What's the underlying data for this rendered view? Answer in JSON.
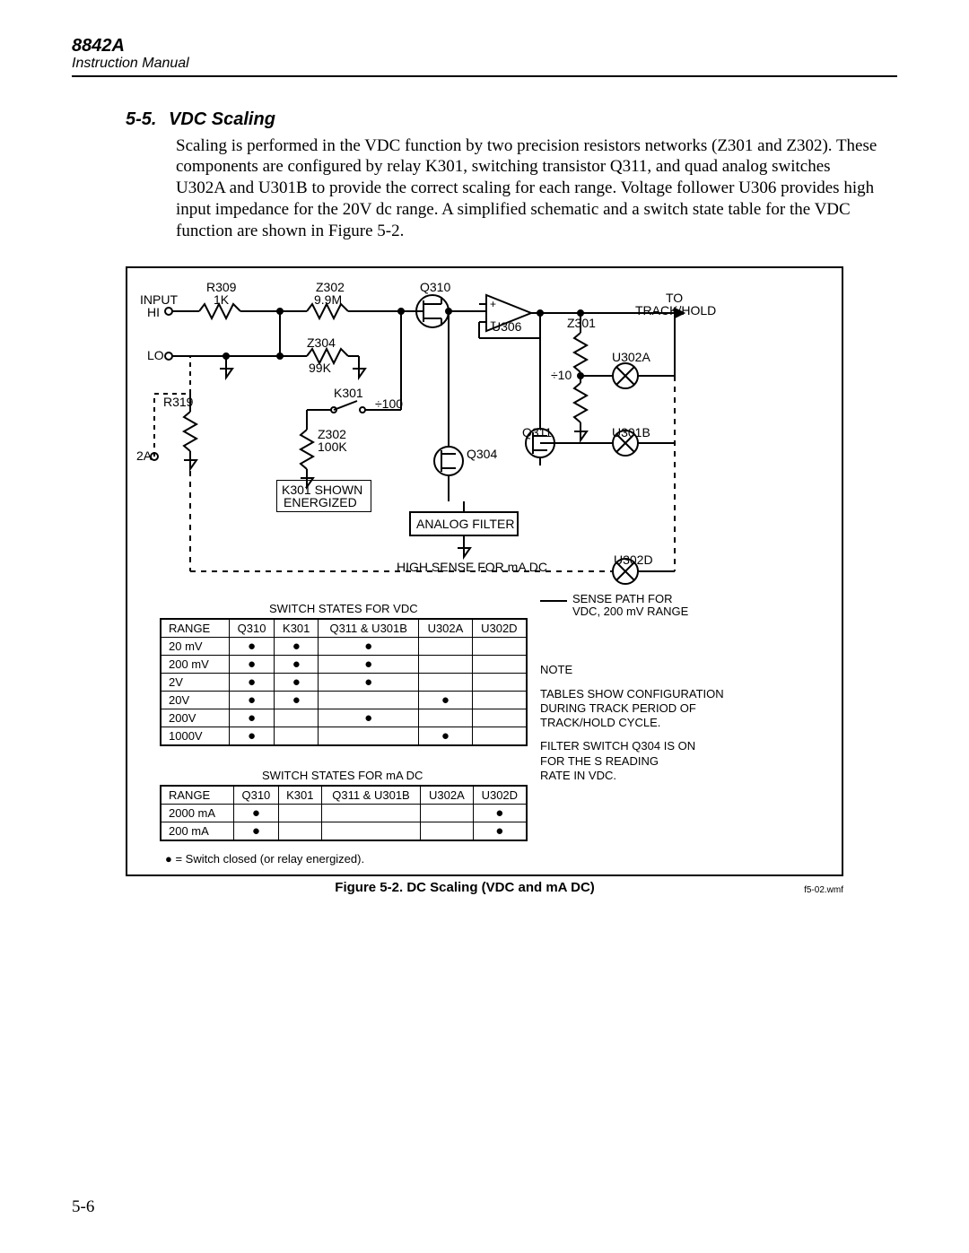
{
  "header": {
    "model": "8842A",
    "subtitle": "Instruction Manual"
  },
  "section": {
    "number": "5-5.",
    "title": "VDC Scaling"
  },
  "body": "Scaling is performed in the VDC function by two precision resistors networks (Z301 and Z302). These components are configured by relay K301, switching transistor Q311, and quad analog switches U302A and U301B to provide the correct scaling for each range. Voltage follower U306 provides high input impedance for the 20V dc range. A simplified schematic and a switch state table for the VDC function are shown in Figure 5-2.",
  "fig": {
    "labels": {
      "input": "INPUT",
      "hi": "HI",
      "lo": "LO",
      "r309": "R309",
      "r309_val": "1K",
      "z302_top": "Z302",
      "z302_top_val": "9.9M",
      "q310": "Q310",
      "u306": "U306",
      "z301": "Z301",
      "to": "TO",
      "trackhold": "TRACK/HOLD",
      "z304": "Z304",
      "z304_val": "99K",
      "u302a": "U302A",
      "div10": "÷10",
      "r319": "R319",
      "k301": "K301",
      "div100": "÷100",
      "z302_bot": "Z302",
      "z302_bot_val": "100K",
      "q304": "Q304",
      "q311": "Q311",
      "u301b": "U301B",
      "twoA": "2A",
      "k301_shown": "K301 SHOWN",
      "energized": "ENERGIZED",
      "analog_filter": "ANALOG FILTER",
      "u302d": "U302D",
      "high_sense": "HIGH SENSE FOR mA DC",
      "sense_path1": "SENSE PATH FOR",
      "sense_path2": "VDC, 200 mV RANGE"
    },
    "table_vdc": {
      "title": "SWITCH STATES FOR VDC",
      "headers": [
        "RANGE",
        "Q310",
        "K301",
        "Q311 & U301B",
        "U302A",
        "U302D"
      ],
      "rows": [
        {
          "range": "20 mV",
          "q310": true,
          "k301": true,
          "q311": true,
          "u302a": false,
          "u302d": false
        },
        {
          "range": "200 mV",
          "q310": true,
          "k301": true,
          "q311": true,
          "u302a": false,
          "u302d": false
        },
        {
          "range": "2V",
          "q310": true,
          "k301": true,
          "q311": true,
          "u302a": false,
          "u302d": false
        },
        {
          "range": "20V",
          "q310": true,
          "k301": true,
          "q311": false,
          "u302a": true,
          "u302d": false
        },
        {
          "range": "200V",
          "q310": true,
          "k301": false,
          "q311": true,
          "u302a": false,
          "u302d": false
        },
        {
          "range": "1000V",
          "q310": true,
          "k301": false,
          "q311": false,
          "u302a": true,
          "u302d": false
        }
      ]
    },
    "table_ma": {
      "title": "SWITCH STATES FOR mA DC",
      "headers": [
        "RANGE",
        "Q310",
        "K301",
        "Q311 & U301B",
        "U302A",
        "U302D"
      ],
      "rows": [
        {
          "range": "2000 mA",
          "q310": true,
          "k301": false,
          "q311": false,
          "u302a": false,
          "u302d": true
        },
        {
          "range": "200 mA",
          "q310": true,
          "k301": false,
          "q311": false,
          "u302a": false,
          "u302d": true
        }
      ]
    },
    "footnote": "● = Switch closed (or relay energized).",
    "note": {
      "title": "NOTE",
      "line1": "TABLES SHOW CONFIGURATION",
      "line2": "DURING TRACK PERIOD OF",
      "line3": "TRACK/HOLD CYCLE.",
      "line4": "FILTER SWITCH Q304 IS ON",
      "line5": "FOR THE S READING",
      "line6": "RATE IN VDC."
    },
    "caption": "Figure 5-2. DC Scaling (VDC and mA DC)",
    "srcfile": "f5-02.wmf"
  },
  "pagenum": "5-6"
}
